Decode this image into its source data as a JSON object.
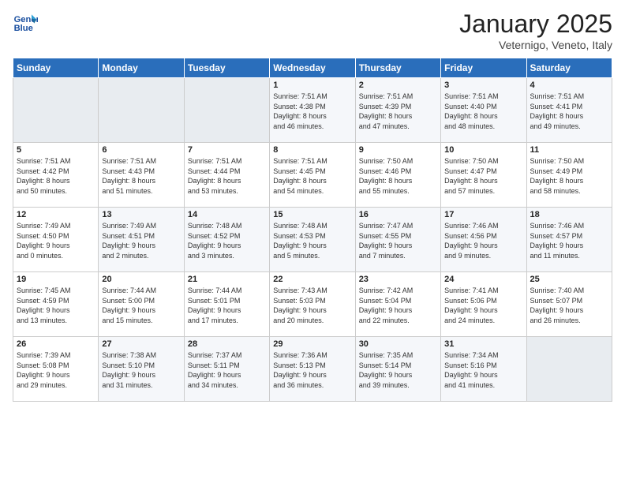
{
  "logo": {
    "general": "General",
    "blue": "Blue"
  },
  "header": {
    "month": "January 2025",
    "location": "Veternigo, Veneto, Italy"
  },
  "weekdays": [
    "Sunday",
    "Monday",
    "Tuesday",
    "Wednesday",
    "Thursday",
    "Friday",
    "Saturday"
  ],
  "weeks": [
    [
      {
        "day": "",
        "info": ""
      },
      {
        "day": "",
        "info": ""
      },
      {
        "day": "",
        "info": ""
      },
      {
        "day": "1",
        "info": "Sunrise: 7:51 AM\nSunset: 4:38 PM\nDaylight: 8 hours\nand 46 minutes."
      },
      {
        "day": "2",
        "info": "Sunrise: 7:51 AM\nSunset: 4:39 PM\nDaylight: 8 hours\nand 47 minutes."
      },
      {
        "day": "3",
        "info": "Sunrise: 7:51 AM\nSunset: 4:40 PM\nDaylight: 8 hours\nand 48 minutes."
      },
      {
        "day": "4",
        "info": "Sunrise: 7:51 AM\nSunset: 4:41 PM\nDaylight: 8 hours\nand 49 minutes."
      }
    ],
    [
      {
        "day": "5",
        "info": "Sunrise: 7:51 AM\nSunset: 4:42 PM\nDaylight: 8 hours\nand 50 minutes."
      },
      {
        "day": "6",
        "info": "Sunrise: 7:51 AM\nSunset: 4:43 PM\nDaylight: 8 hours\nand 51 minutes."
      },
      {
        "day": "7",
        "info": "Sunrise: 7:51 AM\nSunset: 4:44 PM\nDaylight: 8 hours\nand 53 minutes."
      },
      {
        "day": "8",
        "info": "Sunrise: 7:51 AM\nSunset: 4:45 PM\nDaylight: 8 hours\nand 54 minutes."
      },
      {
        "day": "9",
        "info": "Sunrise: 7:50 AM\nSunset: 4:46 PM\nDaylight: 8 hours\nand 55 minutes."
      },
      {
        "day": "10",
        "info": "Sunrise: 7:50 AM\nSunset: 4:47 PM\nDaylight: 8 hours\nand 57 minutes."
      },
      {
        "day": "11",
        "info": "Sunrise: 7:50 AM\nSunset: 4:49 PM\nDaylight: 8 hours\nand 58 minutes."
      }
    ],
    [
      {
        "day": "12",
        "info": "Sunrise: 7:49 AM\nSunset: 4:50 PM\nDaylight: 9 hours\nand 0 minutes."
      },
      {
        "day": "13",
        "info": "Sunrise: 7:49 AM\nSunset: 4:51 PM\nDaylight: 9 hours\nand 2 minutes."
      },
      {
        "day": "14",
        "info": "Sunrise: 7:48 AM\nSunset: 4:52 PM\nDaylight: 9 hours\nand 3 minutes."
      },
      {
        "day": "15",
        "info": "Sunrise: 7:48 AM\nSunset: 4:53 PM\nDaylight: 9 hours\nand 5 minutes."
      },
      {
        "day": "16",
        "info": "Sunrise: 7:47 AM\nSunset: 4:55 PM\nDaylight: 9 hours\nand 7 minutes."
      },
      {
        "day": "17",
        "info": "Sunrise: 7:46 AM\nSunset: 4:56 PM\nDaylight: 9 hours\nand 9 minutes."
      },
      {
        "day": "18",
        "info": "Sunrise: 7:46 AM\nSunset: 4:57 PM\nDaylight: 9 hours\nand 11 minutes."
      }
    ],
    [
      {
        "day": "19",
        "info": "Sunrise: 7:45 AM\nSunset: 4:59 PM\nDaylight: 9 hours\nand 13 minutes."
      },
      {
        "day": "20",
        "info": "Sunrise: 7:44 AM\nSunset: 5:00 PM\nDaylight: 9 hours\nand 15 minutes."
      },
      {
        "day": "21",
        "info": "Sunrise: 7:44 AM\nSunset: 5:01 PM\nDaylight: 9 hours\nand 17 minutes."
      },
      {
        "day": "22",
        "info": "Sunrise: 7:43 AM\nSunset: 5:03 PM\nDaylight: 9 hours\nand 20 minutes."
      },
      {
        "day": "23",
        "info": "Sunrise: 7:42 AM\nSunset: 5:04 PM\nDaylight: 9 hours\nand 22 minutes."
      },
      {
        "day": "24",
        "info": "Sunrise: 7:41 AM\nSunset: 5:06 PM\nDaylight: 9 hours\nand 24 minutes."
      },
      {
        "day": "25",
        "info": "Sunrise: 7:40 AM\nSunset: 5:07 PM\nDaylight: 9 hours\nand 26 minutes."
      }
    ],
    [
      {
        "day": "26",
        "info": "Sunrise: 7:39 AM\nSunset: 5:08 PM\nDaylight: 9 hours\nand 29 minutes."
      },
      {
        "day": "27",
        "info": "Sunrise: 7:38 AM\nSunset: 5:10 PM\nDaylight: 9 hours\nand 31 minutes."
      },
      {
        "day": "28",
        "info": "Sunrise: 7:37 AM\nSunset: 5:11 PM\nDaylight: 9 hours\nand 34 minutes."
      },
      {
        "day": "29",
        "info": "Sunrise: 7:36 AM\nSunset: 5:13 PM\nDaylight: 9 hours\nand 36 minutes."
      },
      {
        "day": "30",
        "info": "Sunrise: 7:35 AM\nSunset: 5:14 PM\nDaylight: 9 hours\nand 39 minutes."
      },
      {
        "day": "31",
        "info": "Sunrise: 7:34 AM\nSunset: 5:16 PM\nDaylight: 9 hours\nand 41 minutes."
      },
      {
        "day": "",
        "info": ""
      }
    ]
  ]
}
